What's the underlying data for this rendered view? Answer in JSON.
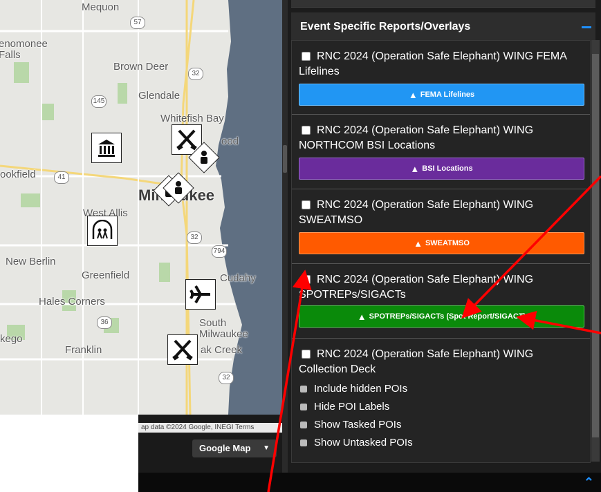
{
  "map": {
    "labels": {
      "mequon": "Mequon",
      "menomonee_falls": "enomonee\nFalls",
      "brown_deer": "Brown Deer",
      "glendale": "Glendale",
      "whitefish_bay": "Whitefish Bay",
      "shorewood": "ood",
      "brookfield": "ookfield",
      "milwaukee": "Milwaukee",
      "west_allis": "West Allis",
      "new_berlin": "New Berlin",
      "greenfield": "Greenfield",
      "cudahy": "Cudahy",
      "hales_corners": "Hales Corners",
      "south_milwaukee": "South\nMilwaukee",
      "muskego": "kego",
      "franklin": "Franklin",
      "oak_creek": "ak Creek"
    },
    "shields": [
      "57",
      "32",
      "145",
      "41",
      "32",
      "794",
      "36",
      "32"
    ],
    "attribution": "ap data ©2024 Google, INEGI  Terms",
    "map_type_button": "Google Map"
  },
  "panel": {
    "section_title": "Event Specific Reports/Overlays",
    "items": [
      {
        "name": "RNC 2024 (Operation Safe Elephant) WING FEMA Lifelines",
        "button": "FEMA Lifelines",
        "color": "#2196f3"
      },
      {
        "name": "RNC 2024 (Operation Safe Elephant) WING NORTHCOM BSI Locations",
        "button": "BSI Locations",
        "color": "#6a2c9c"
      },
      {
        "name": "RNC 2024 (Operation Safe Elephant) WING SWEATMSO",
        "button": "SWEATMSO",
        "color": "#ff5a00"
      },
      {
        "name": "RNC 2024 (Operation Safe Elephant) WING SPOTREPs/SIGACTs",
        "button": "SPOTREPs/SIGACTs (Spot Report/SIGACT)",
        "color": "#0a8a0a"
      },
      {
        "name": "RNC 2024 (Operation Safe Elephant) WING Collection Deck"
      }
    ],
    "options": [
      "Include hidden POIs",
      "Hide POI Labels",
      "Show Tasked POIs",
      "Show Untasked POIs"
    ]
  },
  "colors": {
    "accent": "#1e90ff",
    "annotation": "#ff0000"
  }
}
